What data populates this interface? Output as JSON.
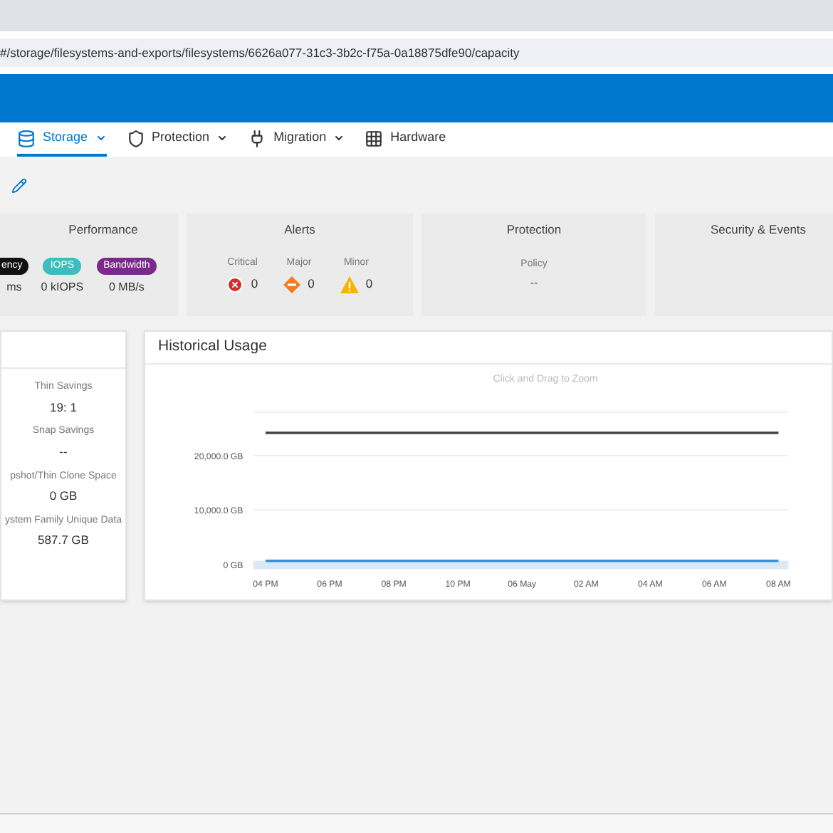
{
  "address_bar": {
    "url": "#/storage/filesystems-and-exports/filesystems/6626a077-31c3-3b2c-f75a-0a18875dfe90/capacity"
  },
  "nav": [
    {
      "label": "Storage",
      "dropdown": true,
      "selected": true
    },
    {
      "label": "Protection",
      "dropdown": true,
      "selected": false
    },
    {
      "label": "Migration",
      "dropdown": true,
      "selected": false
    },
    {
      "label": "Hardware",
      "dropdown": false,
      "selected": false
    }
  ],
  "summary": {
    "performance": {
      "title": "Performance",
      "metrics": [
        {
          "label": "ency",
          "value": "ms",
          "color": "#111111"
        },
        {
          "label": "IOPS",
          "value": "0 kIOPS",
          "color": "#3dbdbd"
        },
        {
          "label": "Bandwidth",
          "value": "0 MB/s",
          "color": "#7b2a8c"
        }
      ]
    },
    "alerts": {
      "title": "Alerts",
      "items": [
        {
          "label": "Critical",
          "value": "0",
          "kind": "critical"
        },
        {
          "label": "Major",
          "value": "0",
          "kind": "major"
        },
        {
          "label": "Minor",
          "value": "0",
          "kind": "minor"
        }
      ]
    },
    "protection": {
      "title": "Protection",
      "label": "Policy",
      "value": "--"
    },
    "security": {
      "title": "Security & Events"
    }
  },
  "savings": [
    {
      "label": "Thin Savings",
      "value": "19: 1"
    },
    {
      "label": "Snap Savings",
      "value": "--"
    },
    {
      "label": "pshot/Thin Clone Space",
      "value": "0 GB"
    },
    {
      "label": "ystem Family Unique Data",
      "value": "587.7 GB"
    }
  ],
  "historical_usage": {
    "title": "Historical Usage",
    "hint": "Click and Drag to Zoom",
    "chart_data": {
      "type": "line",
      "categories": [
        "04 PM",
        "06 PM",
        "08 PM",
        "10 PM",
        "06 May",
        "02 AM",
        "04 AM",
        "06 AM",
        "08 AM"
      ],
      "ylim": [
        0,
        28000
      ],
      "yticks": [
        {
          "value": 0,
          "label": "0 GB"
        },
        {
          "value": 10000,
          "label": "10,000.0 GB"
        },
        {
          "value": 20000,
          "label": "20,000.0 GB"
        }
      ],
      "series": [
        {
          "color": "#444444",
          "values": [
            24200,
            24200,
            24200,
            24200,
            24200,
            24200,
            24200,
            24200,
            24200
          ]
        },
        {
          "color": "#3a8fd9",
          "values": [
            600,
            600,
            600,
            600,
            600,
            600,
            600,
            600,
            600
          ]
        }
      ]
    }
  }
}
